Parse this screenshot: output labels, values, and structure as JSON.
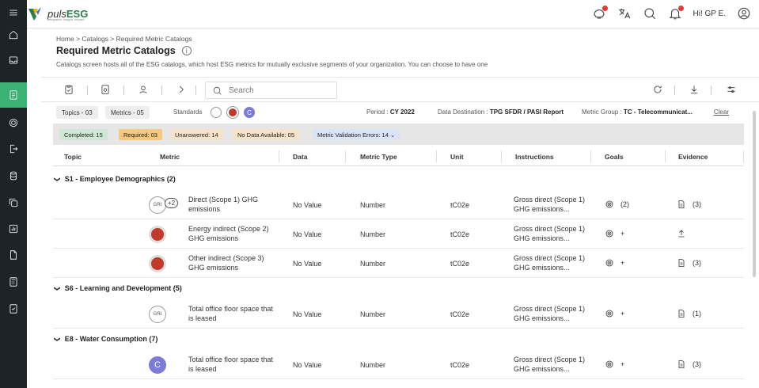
{
  "app": {
    "brand": "puls",
    "brand_bold": "ESG",
    "tagline": "integrated. Insight. Impact.",
    "greeting": "Hi! GP E."
  },
  "rail": {
    "items": [
      {
        "icon": "menu-icon"
      },
      {
        "icon": "home-icon"
      },
      {
        "icon": "inbox-icon"
      },
      {
        "icon": "catalog-icon",
        "active": true
      },
      {
        "icon": "target-icon"
      },
      {
        "icon": "export-icon"
      },
      {
        "icon": "database-icon"
      },
      {
        "icon": "copy-icon"
      },
      {
        "icon": "chart-icon"
      },
      {
        "icon": "document-icon"
      },
      {
        "icon": "calculator-icon"
      },
      {
        "icon": "checklist-icon"
      }
    ]
  },
  "breadcrumb": [
    "Home",
    "Catalogs",
    "Required Metric Catalogs"
  ],
  "page": {
    "title": "Required Metric Catalogs",
    "description": "Catalogs screen hosts all of the ESG catalogs, which host ESG metrics for mutually exclusive segments of your organization. You can choose to have one"
  },
  "search": {
    "placeholder": "Search"
  },
  "filters": {
    "topics": "Topics - 03",
    "metrics": "Metrics - 05",
    "standards_label": "Standards",
    "period_label": "Period :",
    "period_value": "CY 2022",
    "destination_label": "Data Destination :",
    "destination_value": "TPG SFDR / PASI Report",
    "group_label": "Metric Group :",
    "group_value": "TC - Telecommunicat...",
    "clear": "Clear"
  },
  "status": {
    "completed": "Completed: 15",
    "required": "Required: 03",
    "unanswered": "Unanswered: 14",
    "no_data": "No Data Available: 05",
    "validation": "Metric Validation Errors: 14 ⌄"
  },
  "colors": {
    "accent": "#3bb273",
    "completed_bg": "#cfe8d3",
    "required_bg": "#f7c77e",
    "unanswered_bg": "#f6e3c9",
    "no_data_bg": "#f6e3c9",
    "validation_bg": "#d9e4f6",
    "badge_purple": "#7b7bd8"
  },
  "table": {
    "headers": [
      "Topic",
      "Metric",
      "Data",
      "Metric Type",
      "Unit",
      "Instructions",
      "Goals",
      "Evidence"
    ],
    "groups": [
      {
        "label": "S1 - Employee Demographics (2)",
        "rows": [
          {
            "metric": "Direct (Scope 1) GHG emissions",
            "data": "No Value",
            "type": "Number",
            "unit": "tC02e",
            "instr": "Gross direct (Scope 1) GHG emissions...",
            "goals": "(2)",
            "evidence": "(3)",
            "badge": "gri",
            "extra": "+2",
            "evid_icon": "file"
          },
          {
            "metric": "Energy indirect (Scope 2) GHG emissions",
            "data": "No Value",
            "type": "Number",
            "unit": "tC02e",
            "instr": "Gross direct (Scope 1) GHG emissions...",
            "goals": "+",
            "evidence": "",
            "badge": "red",
            "extra": "",
            "evid_icon": "upload"
          },
          {
            "metric": "Other indirect (Scope 3) GHG emissions",
            "data": "No Value",
            "type": "Number",
            "unit": "tC02e",
            "instr": "Gross direct (Scope 1) GHG emissions...",
            "goals": "+",
            "evidence": "(3)",
            "badge": "red",
            "extra": "",
            "evid_icon": "file"
          }
        ]
      },
      {
        "label": "S6 - Learning and Development (5)",
        "rows": [
          {
            "metric": "Total office floor space that is leased",
            "data": "No Value",
            "type": "Number",
            "unit": "tC02e",
            "instr": "Gross direct (Scope 1) GHG emissions...",
            "goals": "+",
            "evidence": "(1)",
            "badge": "gri",
            "extra": "",
            "evid_icon": "file"
          }
        ]
      },
      {
        "label": "E8 - Water Consumption (7)",
        "rows": [
          {
            "metric": "Total office floor space that is leased",
            "data": "No Value",
            "type": "Number",
            "unit": "tC02e",
            "instr": "Gross direct (Scope 1) GHG emissions...",
            "goals": "+",
            "evidence": "(3)",
            "badge": "c",
            "extra": "",
            "evid_icon": "file"
          }
        ]
      }
    ]
  }
}
